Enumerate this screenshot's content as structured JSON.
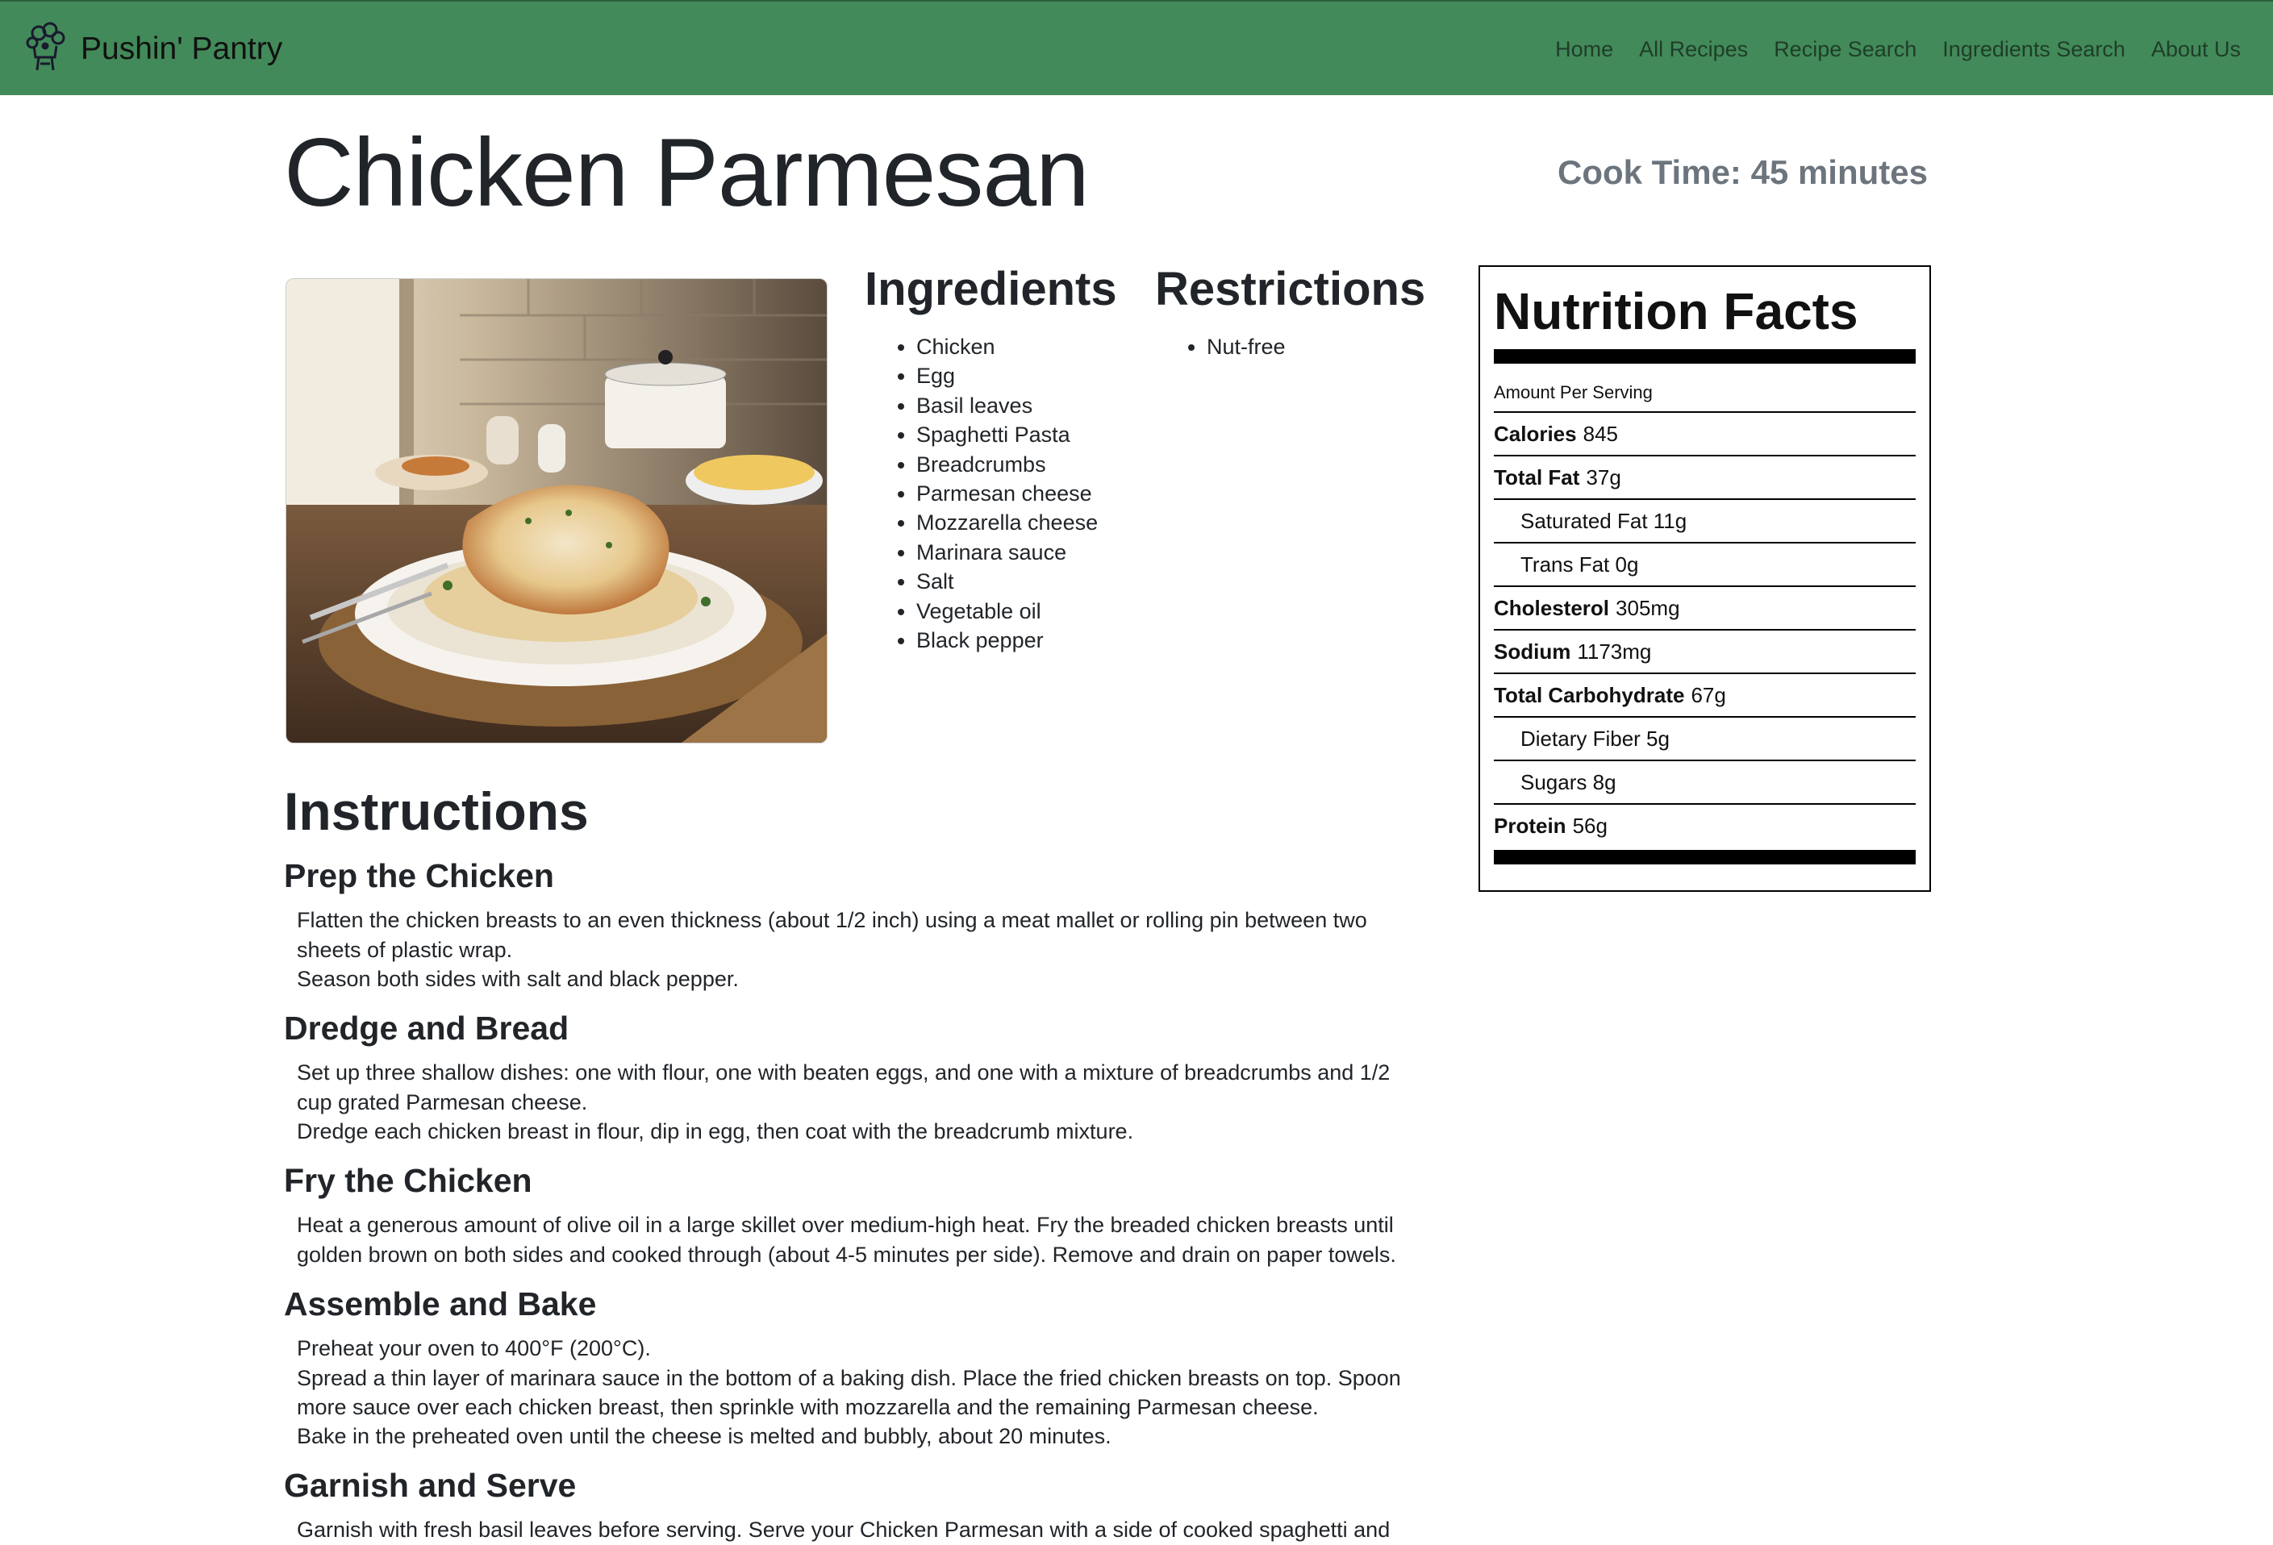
{
  "brand": {
    "name": "Pushin' Pantry",
    "icon": "chef-logo-icon"
  },
  "nav": {
    "links": [
      "Home",
      "All Recipes",
      "Recipe Search",
      "Ingredients Search",
      "About Us"
    ]
  },
  "recipe": {
    "title": "Chicken Parmesan",
    "cook_time": "Cook Time: 45 minutes",
    "image_alt": "Chicken Parmesan plated over spaghetti"
  },
  "ingredients": {
    "heading": "Ingredients",
    "items": [
      "Chicken",
      "Egg",
      "Basil leaves",
      "Spaghetti Pasta",
      "Breadcrumbs",
      "Parmesan cheese",
      "Mozzarella cheese",
      "Marinara sauce",
      "Salt",
      "Vegetable oil",
      "Black pepper"
    ]
  },
  "restrictions": {
    "heading": "Restrictions",
    "items": [
      "Nut-free"
    ]
  },
  "nutrition": {
    "title": "Nutrition Facts",
    "serving_label": "Amount Per Serving",
    "rows": [
      {
        "label": "Calories",
        "value": "845"
      },
      {
        "label": "Total Fat",
        "value": "37g"
      },
      {
        "label": "Saturated Fat 11g",
        "value": ""
      },
      {
        "label": "Trans Fat 0g",
        "value": ""
      },
      {
        "label": "Cholesterol",
        "value": "305mg"
      },
      {
        "label": "Sodium",
        "value": "1173mg"
      },
      {
        "label": "Total Carbohydrate",
        "value": "67g"
      },
      {
        "label": "Dietary Fiber 5g",
        "value": ""
      },
      {
        "label": "Sugars 8g",
        "value": ""
      },
      {
        "label": "Protein",
        "value": "56g"
      }
    ]
  },
  "instructions": {
    "heading": "Instructions",
    "steps": [
      {
        "title": "Prep the Chicken",
        "lines": [
          "Flatten the chicken breasts to an even thickness (about 1/2 inch) using a meat mallet or rolling pin between two sheets of plastic wrap.",
          "Season both sides with salt and black pepper."
        ]
      },
      {
        "title": "Dredge and Bread",
        "lines": [
          "Set up three shallow dishes: one with flour, one with beaten eggs, and one with a mixture of breadcrumbs and 1/2 cup grated Parmesan cheese.",
          "Dredge each chicken breast in flour, dip in egg, then coat with the breadcrumb mixture."
        ]
      },
      {
        "title": "Fry the Chicken",
        "lines": [
          "Heat a generous amount of olive oil in a large skillet over medium-high heat. Fry the breaded chicken breasts until golden brown on both sides and cooked through (about 4-5 minutes per side). Remove and drain on paper towels."
        ]
      },
      {
        "title": "Assemble and Bake",
        "lines": [
          "Preheat your oven to 400°F (200°C).",
          "Spread a thin layer of marinara sauce in the bottom of a baking dish. Place the fried chicken breasts on top. Spoon more sauce over each chicken breast, then sprinkle with mozzarella and the remaining Parmesan cheese.",
          "Bake in the preheated oven until the cheese is melted and bubbly, about 20 minutes."
        ]
      },
      {
        "title": "Garnish and Serve",
        "lines": [
          "Garnish with fresh basil leaves before serving. Serve your Chicken Parmesan with a side of cooked spaghetti and"
        ]
      }
    ]
  },
  "colors": {
    "navbar": "#428a59",
    "cook_time": "#6c757d"
  }
}
